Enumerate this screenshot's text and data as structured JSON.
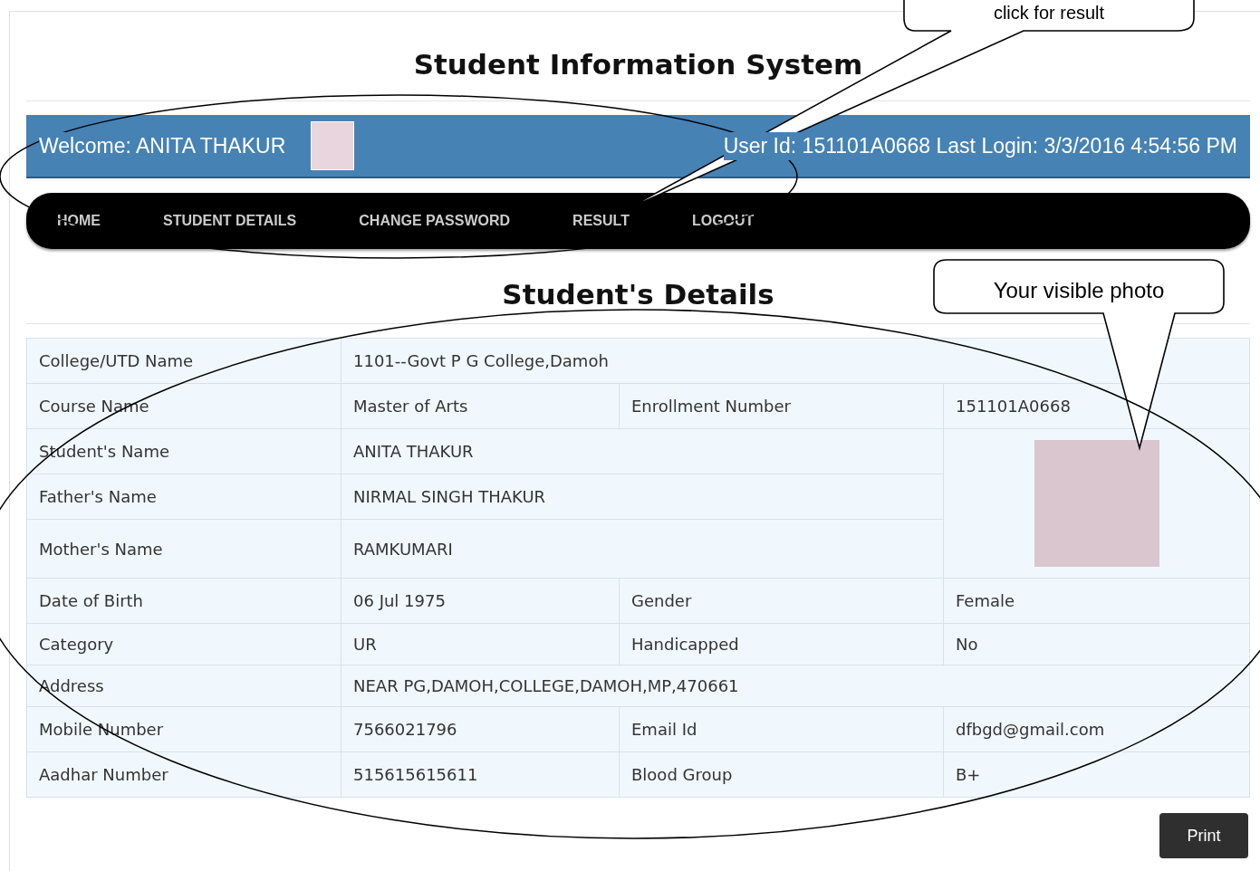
{
  "title": "Student Information System",
  "header": {
    "welcome": "Welcome: ANITA THAKUR",
    "login_info": "User Id: 151101A0668 Last Login: 3/3/2016 4:54:56 PM"
  },
  "nav": [
    {
      "label": "HOME"
    },
    {
      "label": "STUDENT DETAILS"
    },
    {
      "label": "CHANGE PASSWORD"
    },
    {
      "label": "RESULT"
    },
    {
      "label": "LOGOUT"
    }
  ],
  "details": {
    "heading": "Student's Details",
    "rows": [
      {
        "cells": [
          {
            "text": "College/UTD Name"
          },
          {
            "text": "1101--Govt P G College,Damoh",
            "colspan": 3
          }
        ]
      },
      {
        "cells": [
          {
            "text": "Course Name"
          },
          {
            "text": "Master of Arts"
          },
          {
            "text": "Enrollment Number"
          },
          {
            "text": "151101A0668"
          }
        ]
      },
      {
        "cells": [
          {
            "text": "Student's Name"
          },
          {
            "text": "ANITA THAKUR",
            "colspan": 2
          },
          {
            "kind": "photo",
            "rowspan": 3
          }
        ]
      },
      {
        "cells": [
          {
            "text": "Father's Name"
          },
          {
            "text": "NIRMAL SINGH THAKUR",
            "colspan": 2
          }
        ]
      },
      {
        "cells": [
          {
            "text": "Mother's Name"
          },
          {
            "text": "RAMKUMARI",
            "colspan": 2
          }
        ]
      },
      {
        "cells": [
          {
            "text": "Date of Birth"
          },
          {
            "text": "06 Jul 1975"
          },
          {
            "text": "Gender"
          },
          {
            "text": "Female"
          }
        ]
      },
      {
        "cells": [
          {
            "text": "Category"
          },
          {
            "text": "UR"
          },
          {
            "text": "Handicapped"
          },
          {
            "text": "No"
          }
        ]
      },
      {
        "cells": [
          {
            "text": "Address"
          },
          {
            "text": "NEAR PG,DAMOH,COLLEGE,DAMOH,MP,470661",
            "colspan": 3
          }
        ]
      },
      {
        "cells": [
          {
            "text": "Mobile Number"
          },
          {
            "text": "7566021796"
          },
          {
            "text": "Email Id"
          },
          {
            "text": "dfbgd@gmail.com"
          }
        ]
      },
      {
        "cells": [
          {
            "text": "Aadhar Number"
          },
          {
            "text": "515615615611"
          },
          {
            "text": "Blood Group"
          },
          {
            "text": "B+"
          }
        ]
      }
    ]
  },
  "print_button": "Print",
  "annotations": [
    {
      "kind": "callout",
      "text": "click for result"
    },
    {
      "kind": "callout",
      "text": "Your visible photo"
    },
    {
      "kind": "ellipse"
    },
    {
      "kind": "ellipse"
    }
  ]
}
